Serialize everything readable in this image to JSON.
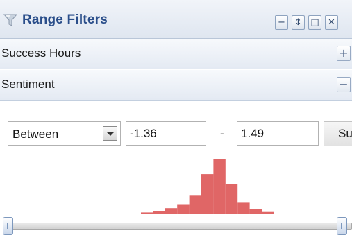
{
  "panel": {
    "title": "Range Filters",
    "icon": "filter-icon",
    "title_buttons": [
      {
        "name": "minimize-button",
        "glyph": "−"
      },
      {
        "name": "resize-button",
        "glyph": "↕"
      },
      {
        "name": "maximize-button",
        "glyph": "□"
      },
      {
        "name": "close-button",
        "glyph": "✕"
      }
    ]
  },
  "sections": [
    {
      "label": "Success Hours",
      "state": "collapsed",
      "toggle": "+"
    },
    {
      "label": "Sentiment",
      "state": "expanded",
      "toggle": "−"
    }
  ],
  "filter": {
    "operator": "Between",
    "min_value": "-1.36",
    "separator": "-",
    "max_value": "1.49",
    "submit_label": "Su"
  },
  "histogram": {
    "color": "#e06666",
    "bins": [
      0.02,
      0.05,
      0.1,
      0.16,
      0.33,
      0.73,
      1.0,
      0.55,
      0.2,
      0.08,
      0.03
    ]
  },
  "slider": {
    "min_position": 0.0,
    "max_position": 1.0
  }
}
